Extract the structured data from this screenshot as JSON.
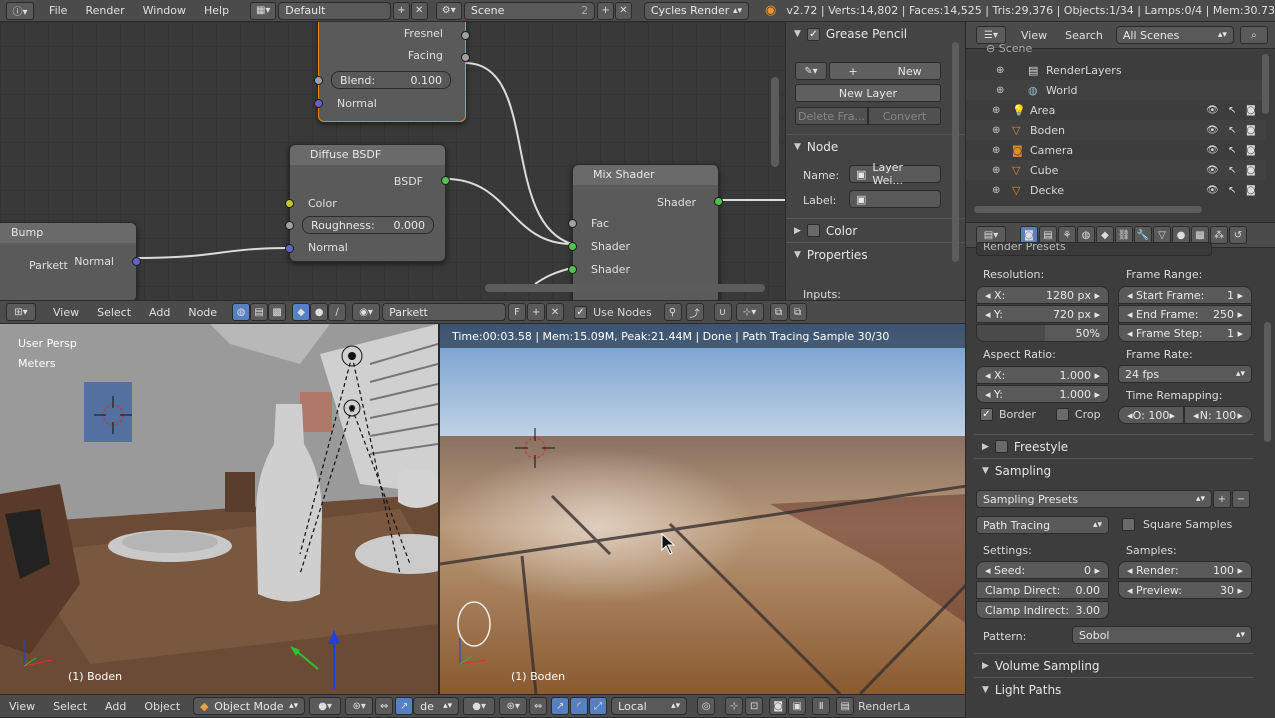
{
  "topbar": {
    "menus": [
      "File",
      "Render",
      "Window",
      "Help"
    ],
    "layout": "Default",
    "scene": "Scene",
    "scene_users": "2",
    "engine": "Cycles Render",
    "stats": "v2.72 | Verts:14,802 | Faces:14,525 | Tris:29,376 | Objects:1/34 | Lamps:0/4 | Mem:30.73"
  },
  "node_editor": {
    "nodes": {
      "top_outputs": [
        "Fresnel",
        "Facing"
      ],
      "blend_label": "Blend:",
      "blend_value": "0.100",
      "normal": "Normal",
      "diffuse_title": "Diffuse BSDF",
      "diffuse_out": "BSDF",
      "color": "Color",
      "roughness_label": "Roughness:",
      "roughness_value": "0.000",
      "bump_title": "Bump",
      "bump_out": "Normal",
      "bump_label": "Parkett",
      "mix_title": "Mix Shader",
      "mix_out": "Shader",
      "mix_fac": "Fac",
      "mix_shader_a": "Shader",
      "mix_shader_b": "Shader"
    },
    "header": {
      "menus": [
        "View",
        "Select",
        "Add",
        "Node"
      ],
      "material": "Parkett",
      "material_flag": "F",
      "use_nodes": "Use Nodes"
    }
  },
  "node_sidebar": {
    "grease_pencil": "Grease Pencil",
    "new": "New",
    "new_layer": "New Layer",
    "delete_frame": "Delete Fra...",
    "convert": "Convert",
    "node_section": "Node",
    "name_label": "Name:",
    "name_value": "Layer Wei...",
    "label_label": "Label:",
    "color_section": "Color",
    "properties_section": "Properties",
    "inputs": "Inputs:"
  },
  "outliner": {
    "menus": [
      "View",
      "Search"
    ],
    "filter": "All Scenes",
    "root": "Scene",
    "items": [
      {
        "name": "RenderLayers",
        "icon": "renderlayers-icon"
      },
      {
        "name": "World",
        "icon": "world-icon"
      },
      {
        "name": "Area",
        "icon": "lamp-icon"
      },
      {
        "name": "Boden",
        "icon": "mesh-icon"
      },
      {
        "name": "Camera",
        "icon": "camera-icon"
      },
      {
        "name": "Cube",
        "icon": "mesh-icon"
      },
      {
        "name": "Decke",
        "icon": "mesh-icon"
      }
    ]
  },
  "properties": {
    "presets_label": "Render Presets",
    "resolution": "Resolution:",
    "res_x": "1280 px",
    "res_y": "720 px",
    "res_pct": "50%",
    "frame_range": "Frame Range:",
    "start_frame": "1",
    "end_frame": "250",
    "frame_step": "1",
    "start_label": "Start Frame:",
    "end_label": "End Frame:",
    "step_label": "Frame Step:",
    "aspect": "Aspect Ratio:",
    "asp_x": "1.000",
    "asp_y": "1.000",
    "frame_rate": "Frame Rate:",
    "fps": "24 fps",
    "time_remap": "Time Remapping:",
    "remap_old": "O: 100",
    "remap_new": "N: 100",
    "border": "Border",
    "crop": "Crop",
    "freestyle": "Freestyle",
    "sampling": "Sampling",
    "sampling_presets": "Sampling Presets",
    "integrator": "Path Tracing",
    "square_samples": "Square Samples",
    "settings": "Settings:",
    "samples": "Samples:",
    "seed_label": "Seed:",
    "seed": "0",
    "clamp_direct_label": "Clamp Direct:",
    "clamp_direct": "0.00",
    "clamp_indirect_label": "Clamp Indirect:",
    "clamp_indirect": "3.00",
    "render_label": "Render:",
    "render": "100",
    "preview_label": "Preview:",
    "preview": "30",
    "pattern_label": "Pattern:",
    "pattern": "Sobol",
    "volume_sampling": "Volume Sampling",
    "light_paths": "Light Paths",
    "x_label": "X:",
    "y_label": "Y:"
  },
  "viewport_left": {
    "view_name": "User Persp",
    "units": "Meters",
    "object": "(1) Boden"
  },
  "viewport_right": {
    "status": "Time:00:03.58 | Mem:15.09M, Peak:21.44M | Done | Path Tracing Sample 30/30",
    "object": "(1) Boden"
  },
  "bottombar": {
    "menus": [
      "View",
      "Select",
      "Add",
      "Object"
    ],
    "mode": "Object Mode",
    "mode2_fragment": "de",
    "orientation": "Local",
    "render_layer": "RenderLa"
  }
}
